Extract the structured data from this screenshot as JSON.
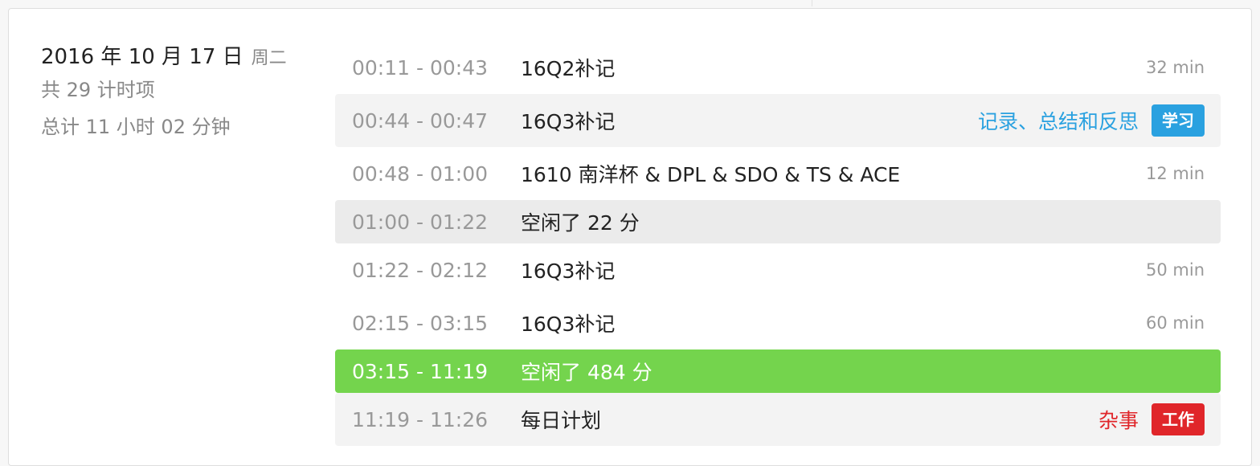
{
  "summary": {
    "date": "2016 年 10 月 17 日",
    "weekday": "周二",
    "count": "共 29 计时项",
    "total": "总计 11 小时 02 分钟"
  },
  "colors": {
    "idle_active_bg": "#74d44d",
    "study_category": "#2aa1e0",
    "study_tag_bg": "#2aa1e0",
    "work_category": "#e0262a",
    "work_tag_bg": "#e0262a"
  },
  "entries": [
    {
      "time": "00:11 - 00:43",
      "title": "16Q2补记",
      "duration": "32 min"
    },
    {
      "time": "00:44 - 00:47",
      "title": "16Q3补记",
      "category": "记录、总结和反思",
      "tag": "学习"
    },
    {
      "time": "00:48 - 01:00",
      "title": "1610 南洋杯 & DPL & SDO & TS & ACE",
      "duration": "12 min"
    },
    {
      "time": "01:00 - 01:22",
      "title": "空闲了 22 分"
    },
    {
      "time": "01:22 - 02:12",
      "title": "16Q3补记",
      "duration": "50 min"
    },
    {
      "time": "02:15 - 03:15",
      "title": "16Q3补记",
      "duration": "60 min"
    },
    {
      "time": "03:15 - 11:19",
      "title": "空闲了 484 分"
    },
    {
      "time": "11:19 - 11:26",
      "title": "每日计划",
      "category": "杂事",
      "tag": "工作"
    }
  ]
}
